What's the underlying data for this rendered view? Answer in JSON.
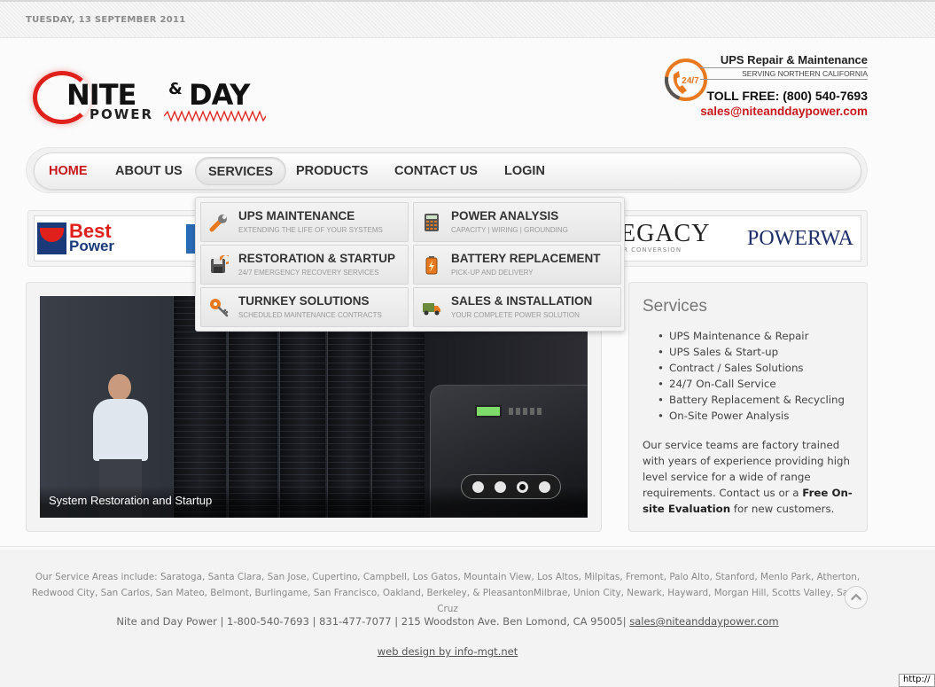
{
  "topbar": {
    "date": "TUESDAY, 13 SEPTEMBER 2011"
  },
  "logo": {
    "nite": "NITE",
    "amp": "&",
    "day": "DAY",
    "power": "POWER"
  },
  "contact": {
    "badge": "24/7",
    "title": "UPS Repair & Maintenance",
    "subtitle": "SERVING NORTHERN CALIFORNIA",
    "tollfree": "TOLL FREE: (800) 540-7693",
    "email": "sales@niteanddaypower.com"
  },
  "nav": {
    "items": [
      {
        "label": "HOME"
      },
      {
        "label": "ABOUT US"
      },
      {
        "label": "SERVICES"
      },
      {
        "label": "PRODUCTS"
      },
      {
        "label": "CONTACT US"
      },
      {
        "label": "LOGIN"
      }
    ]
  },
  "dropdown": {
    "items": [
      {
        "title": "UPS MAINTENANCE",
        "sub": "EXTENDING THE LIFE OF YOUR SYSTEMS",
        "icon": "wrench-icon"
      },
      {
        "title": "POWER ANALYSIS",
        "sub": "CAPACITY | WIRING | GROUNDING",
        "icon": "calculator-icon"
      },
      {
        "title": "RESTORATION & STARTUP",
        "sub": "24/7 EMERGENCY RECOVERY SERVICES",
        "icon": "restore-disk-icon"
      },
      {
        "title": "BATTERY REPLACEMENT",
        "sub": "PICK-UP AND DELIVERY",
        "icon": "battery-icon"
      },
      {
        "title": "TURNKEY SOLUTIONS",
        "sub": "SCHEDULED MAINTENANCE CONTRACTS",
        "icon": "key-icon"
      },
      {
        "title": "SALES & INSTALLATION",
        "sub": "YOUR COMPLETE POWER SOLUTION",
        "icon": "truck-icon"
      }
    ]
  },
  "brands": {
    "best1": "Best",
    "best2": "Power",
    "legacy": "EGACY",
    "legacy_sub": "R CONVERSION",
    "powerware": "POWERWA"
  },
  "slider": {
    "caption": "System Restoration and Startup",
    "dot_count": 4,
    "active_dot": 3
  },
  "services": {
    "title": "Services",
    "items": [
      "UPS Maintenance & Repair",
      "UPS Sales & Start-up",
      "Contract / Sales Solutions",
      "24/7 On-Call Service",
      "Battery Replacement & Recycling",
      "On-Site Power Analysis"
    ],
    "text_before": "Our service teams are factory trained with years of experience providing high level service for a wide of range requirements.  Contact us or a ",
    "text_bold": "Free On-site Evaluation",
    "text_after": " for new customers."
  },
  "footer": {
    "areas": "Our Service Areas include:  Saratoga, Santa Clara, San Jose, Cupertino, Campbell, Los Gatos, Mountain View, Los Altos, Milpitas, Fremont, Palo Alto, Stanford, Menlo Park, Atherton, Redwood City, San Carlos, San Mateo, Belmont, Burlingame, San Francisco, Oakland, Berkeley, & PleasantonMilbrae, Union City, Newark, Hayward, Morgan Hill, Scotts Valley, Santa Cruz",
    "address": "Nite and Day Power | 1-800-540-7693 | 831-477-7077 | 215 Woodston Ave. Ben Lomond, CA  95005|",
    "email": "sales@niteanddaypower.com",
    "credit": "web design by info-mgt.net"
  },
  "statusbar": {
    "url": "http://"
  },
  "colors": {
    "accent_red": "#c8171b",
    "nav_text": "#333333",
    "brand_blue": "#1a3a7a"
  }
}
